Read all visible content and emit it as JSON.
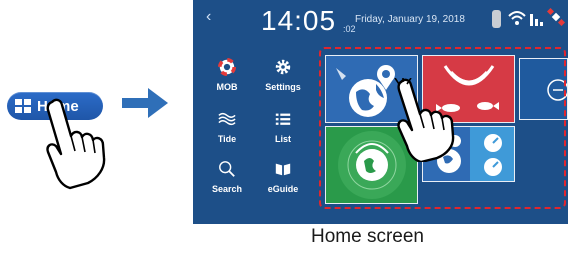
{
  "home_button": {
    "label": "Home",
    "icon": "grid-icon"
  },
  "statusbar": {
    "back_icon": "back-chevron-icon",
    "time": "14:05",
    "seconds": ":02",
    "date": "Friday, January 19, 2018"
  },
  "menu": [
    {
      "label": "MOB",
      "icon": "lifebuoy-icon"
    },
    {
      "label": "Settings",
      "icon": "gear-icon"
    },
    {
      "label": "Tide",
      "icon": "waves-icon"
    },
    {
      "label": "List",
      "icon": "list-icon"
    },
    {
      "label": "Search",
      "icon": "magnifier-icon"
    },
    {
      "label": "eGuide",
      "icon": "book-icon"
    }
  ],
  "caption": "Home screen",
  "colors": {
    "screen_bg": "#1d4f88",
    "highlight_frame": "#e0262f",
    "arrow": "#2f6fb8"
  }
}
